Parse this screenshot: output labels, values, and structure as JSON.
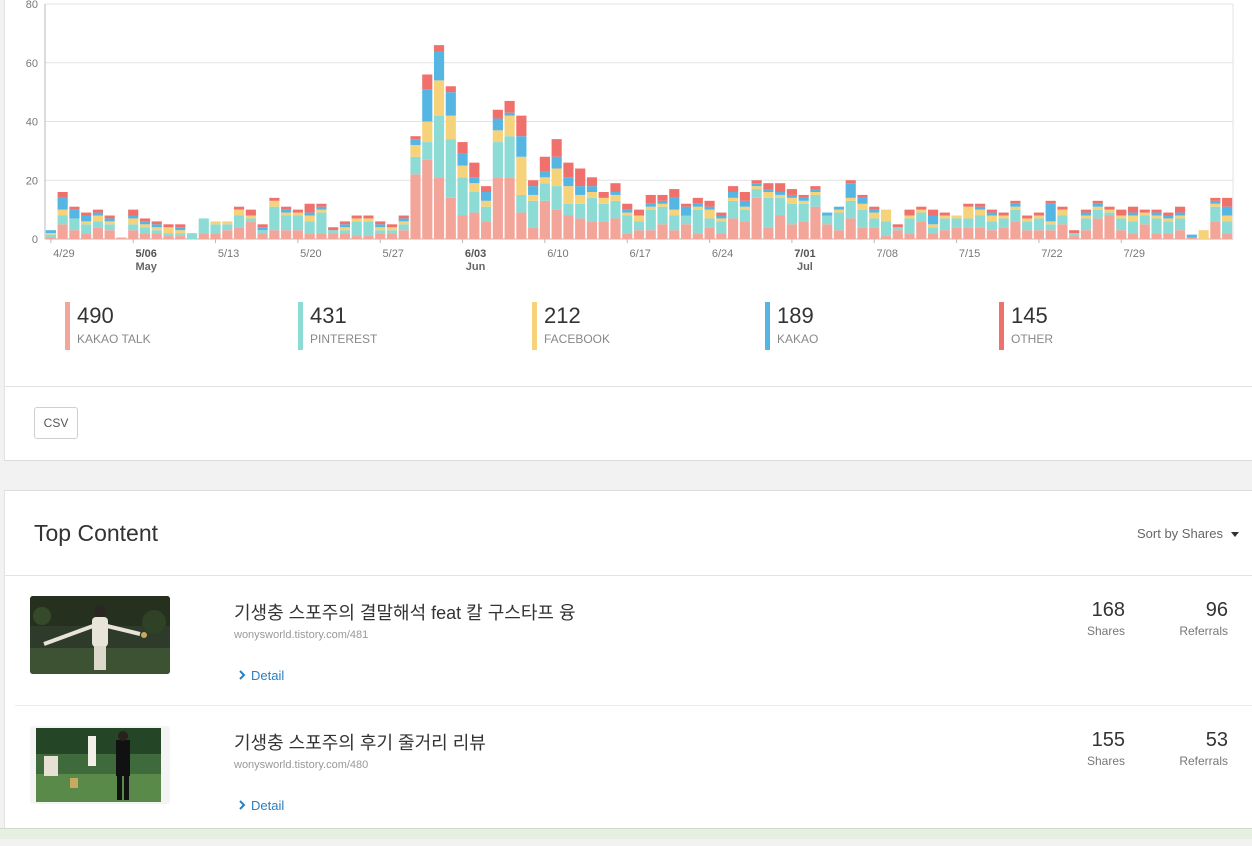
{
  "chart_data": {
    "type": "bar",
    "stacked": true,
    "ylim": [
      0,
      80
    ],
    "yticks": [
      0,
      20,
      40,
      60,
      80
    ],
    "grid": true,
    "x_labels": [
      {
        "day": 0,
        "label": "4/29",
        "sub": ""
      },
      {
        "day": 7,
        "label": "5/06",
        "sub": "May",
        "bold": true
      },
      {
        "day": 14,
        "label": "5/13",
        "sub": ""
      },
      {
        "day": 21,
        "label": "5/20",
        "sub": ""
      },
      {
        "day": 28,
        "label": "5/27",
        "sub": ""
      },
      {
        "day": 35,
        "label": "6/03",
        "sub": "Jun",
        "bold": true
      },
      {
        "day": 42,
        "label": "6/10",
        "sub": ""
      },
      {
        "day": 49,
        "label": "6/17",
        "sub": ""
      },
      {
        "day": 56,
        "label": "6/24",
        "sub": ""
      },
      {
        "day": 63,
        "label": "7/01",
        "sub": "Jul",
        "bold": true
      },
      {
        "day": 70,
        "label": "7/08",
        "sub": ""
      },
      {
        "day": 77,
        "label": "7/15",
        "sub": ""
      },
      {
        "day": 84,
        "label": "7/22",
        "sub": ""
      },
      {
        "day": 91,
        "label": "7/29",
        "sub": ""
      }
    ],
    "series": [
      {
        "name": "KAKAO TALK",
        "color": "#f4a59a",
        "values": [
          0.5,
          5,
          3,
          2,
          4,
          3,
          0.5,
          3,
          2,
          2,
          1,
          1,
          0,
          2,
          2,
          3,
          4,
          6,
          2,
          3,
          3,
          3,
          2,
          2,
          2,
          2,
          1,
          1,
          2,
          2,
          3,
          22,
          27,
          21,
          14,
          8,
          9,
          6,
          21,
          21,
          9,
          4,
          13,
          10,
          8,
          7,
          6,
          6,
          7,
          2,
          3,
          3,
          5,
          3,
          5,
          2,
          4,
          2,
          7,
          6,
          14,
          4,
          8,
          5,
          6,
          11,
          5,
          3,
          7,
          4,
          4,
          1,
          3,
          2,
          6,
          2,
          3,
          4,
          4,
          4,
          3,
          4,
          6,
          3,
          3,
          3,
          5,
          1,
          3,
          7,
          8,
          3,
          2,
          5,
          2,
          2,
          3,
          0.5,
          0,
          6,
          2
        ]
      },
      {
        "name": "PINTEREST",
        "color": "#8ddbd5",
        "values": [
          1,
          3,
          4,
          3,
          2,
          2,
          0,
          2,
          2,
          1,
          1,
          1,
          2,
          5,
          3,
          2,
          4,
          1,
          1,
          8,
          5,
          5,
          4,
          7,
          1,
          1,
          5,
          5,
          1,
          1,
          2,
          6,
          6,
          21,
          20,
          13,
          7,
          5,
          12,
          14,
          6,
          9,
          6,
          8,
          4,
          5,
          8,
          6,
          6,
          6,
          3,
          7,
          6,
          5,
          3,
          8,
          3,
          4,
          6,
          4,
          3,
          10,
          6,
          7,
          6,
          4,
          3,
          6,
          6,
          6,
          3,
          5,
          1,
          5,
          3,
          2,
          4,
          3,
          3,
          4,
          3,
          3,
          4,
          3,
          4,
          2,
          3,
          1,
          4,
          3,
          1,
          4,
          4,
          3,
          5,
          4,
          4,
          0,
          0,
          5,
          4
        ]
      },
      {
        "name": "FACEBOOK",
        "color": "#f6d27a",
        "values": [
          0.5,
          2,
          0,
          1,
          2,
          1,
          0,
          2,
          1,
          1,
          2,
          1,
          0,
          0,
          1,
          1,
          2,
          1,
          0,
          2,
          1,
          1,
          2,
          1,
          0,
          1,
          1,
          1,
          1,
          1,
          1,
          4,
          7,
          12,
          8,
          4,
          3,
          2,
          4,
          7,
          13,
          2,
          2,
          6,
          6,
          3,
          2,
          2,
          2,
          1,
          2,
          1,
          1,
          2,
          0,
          1,
          3,
          1,
          1,
          1,
          1,
          2,
          1,
          2,
          1,
          1,
          0,
          1,
          1,
          2,
          2,
          4,
          0,
          1,
          1,
          1,
          1,
          1,
          4,
          2,
          2,
          1,
          1,
          1,
          1,
          1,
          2,
          0,
          1,
          1,
          1,
          1,
          2,
          1,
          1,
          1,
          1,
          0,
          3,
          1,
          2
        ]
      },
      {
        "name": "KAKAO",
        "color": "#55b6e3",
        "values": [
          1,
          4,
          3,
          2,
          1,
          1,
          0,
          1,
          1,
          1,
          0,
          1,
          0,
          0,
          0,
          0,
          0,
          0,
          1,
          0,
          1,
          0,
          1,
          1,
          0,
          1,
          0,
          0,
          1,
          0,
          1,
          2,
          11,
          10,
          8,
          4,
          2,
          3,
          4,
          1,
          7,
          3,
          2,
          4,
          3,
          3,
          2,
          0,
          1,
          1,
          0,
          1,
          1,
          4,
          3,
          1,
          1,
          1,
          2,
          2,
          1,
          1,
          1,
          1,
          1,
          1,
          1,
          1,
          5,
          2,
          1,
          0,
          0,
          0,
          0,
          3,
          0,
          0,
          0,
          1,
          1,
          0,
          1,
          0,
          0,
          6,
          0,
          0,
          1,
          1,
          0,
          0,
          1,
          0,
          1,
          1,
          1,
          1,
          0,
          1,
          3
        ]
      },
      {
        "name": "OTHER",
        "color": "#f0716b",
        "values": [
          0,
          2,
          1,
          1,
          1,
          1,
          0,
          2,
          1,
          1,
          1,
          1,
          0,
          0,
          0,
          0,
          1,
          2,
          1,
          1,
          1,
          1,
          3,
          1,
          1,
          1,
          1,
          1,
          1,
          1,
          1,
          1,
          5,
          2,
          2,
          4,
          5,
          2,
          3,
          4,
          7,
          2,
          5,
          6,
          5,
          6,
          3,
          2,
          3,
          2,
          2,
          3,
          2,
          3,
          1,
          2,
          2,
          1,
          2,
          3,
          1,
          2,
          3,
          2,
          1,
          1,
          0,
          0,
          1,
          1,
          1,
          0,
          1,
          2,
          1,
          2,
          1,
          0,
          1,
          1,
          1,
          1,
          1,
          1,
          1,
          1,
          1,
          1,
          1,
          1,
          1,
          2,
          2,
          1,
          1,
          1,
          2,
          0,
          0,
          1,
          3
        ]
      }
    ]
  },
  "legend": [
    {
      "value": "490",
      "label": "KAKAO TALK",
      "color": "#f4a59a"
    },
    {
      "value": "431",
      "label": "PINTEREST",
      "color": "#8ddbd5"
    },
    {
      "value": "212",
      "label": "FACEBOOK",
      "color": "#f6d27a"
    },
    {
      "value": "189",
      "label": "KAKAO",
      "color": "#55b6e3"
    },
    {
      "value": "145",
      "label": "OTHER",
      "color": "#f0716b"
    }
  ],
  "csv_label": "CSV",
  "top_content": {
    "title": "Top Content",
    "sort_label": "Sort by Shares",
    "items": [
      {
        "title": "기생충 스포주의 결말해석 feat 칼 구스타프 융",
        "url": "wonysworld.tistory.com/481",
        "detail": "Detail",
        "shares": "168",
        "shares_label": "Shares",
        "referrals": "96",
        "referrals_label": "Referrals"
      },
      {
        "title": "기생충 스포주의 후기 줄거리 리뷰",
        "url": "wonysworld.tistory.com/480",
        "detail": "Detail",
        "shares": "155",
        "shares_label": "Shares",
        "referrals": "53",
        "referrals_label": "Referrals"
      }
    ]
  }
}
